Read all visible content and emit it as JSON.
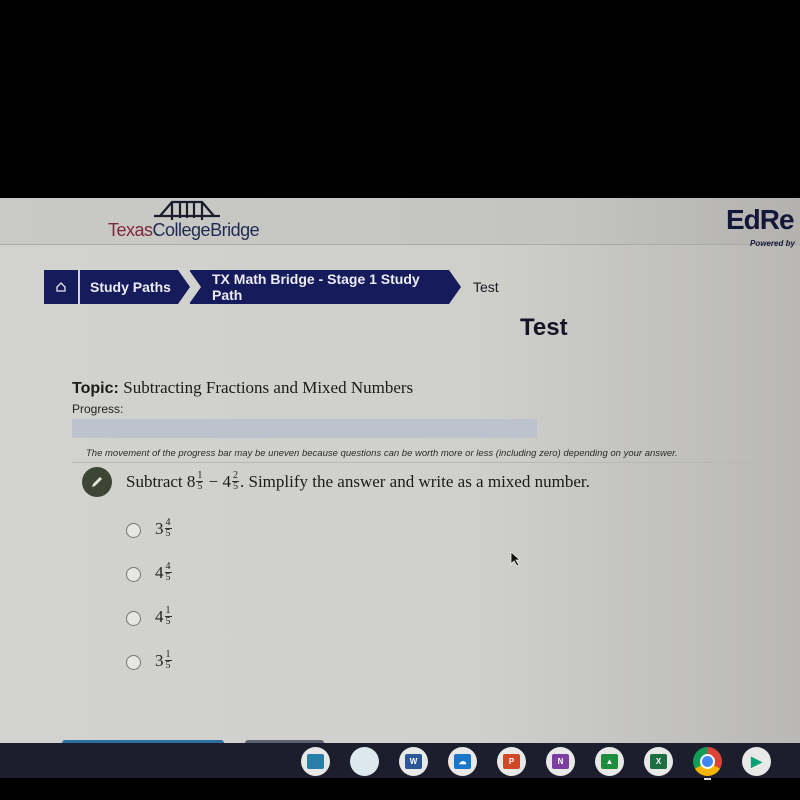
{
  "header": {
    "logo_part1": "Texas",
    "logo_part2": "CollegeBridge",
    "partner_logo": "EdRe",
    "partner_powered": "Powered by"
  },
  "breadcrumb": {
    "home_icon": "home-icon",
    "items": [
      {
        "label": "Study Paths"
      },
      {
        "label": "TX Math Bridge - Stage 1 Study Path"
      }
    ],
    "current": "Test"
  },
  "page": {
    "title": "Test",
    "topic_label": "Topic:",
    "topic_value": "Subtracting Fractions and Mixed Numbers",
    "progress_label": "Progress:",
    "progress_percent": 0,
    "progress_note": "The movement of the progress bar may be uneven because questions can be worth more or less (including zero) depending on your answer."
  },
  "question": {
    "icon": "pencil-icon",
    "prefix": "Subtract",
    "term1_whole": "8",
    "term1_num": "1",
    "term1_den": "5",
    "operator": "−",
    "term2_whole": "4",
    "term2_num": "2",
    "term2_den": "5",
    "suffix": ". Simplify the answer and write as a mixed number.",
    "options": [
      {
        "whole": "3",
        "num": "4",
        "den": "5"
      },
      {
        "whole": "4",
        "num": "4",
        "den": "5"
      },
      {
        "whole": "4",
        "num": "1",
        "den": "5"
      },
      {
        "whole": "3",
        "num": "1",
        "den": "5"
      }
    ]
  },
  "taskbar": {
    "apps": [
      {
        "name": "globe-app",
        "label": "",
        "color": "#2a7fa8"
      },
      {
        "name": "assistant-app",
        "label": "",
        "color": "#cfe6ee"
      },
      {
        "name": "word-app",
        "label": "W",
        "color": "#2b5797"
      },
      {
        "name": "onedrive-app",
        "label": "☁",
        "color": "#1976c9"
      },
      {
        "name": "powerpoint-app",
        "label": "P",
        "color": "#d24726"
      },
      {
        "name": "onenote-app",
        "label": "N",
        "color": "#7b3fa0"
      },
      {
        "name": "classroom-app",
        "label": "▲",
        "color": "#1e8e3e"
      },
      {
        "name": "excel-app",
        "label": "X",
        "color": "#1d6f42"
      },
      {
        "name": "chrome-app",
        "label": "",
        "color": "#db4437"
      },
      {
        "name": "play-store-app",
        "label": "▶",
        "color": "#00a173"
      }
    ]
  }
}
